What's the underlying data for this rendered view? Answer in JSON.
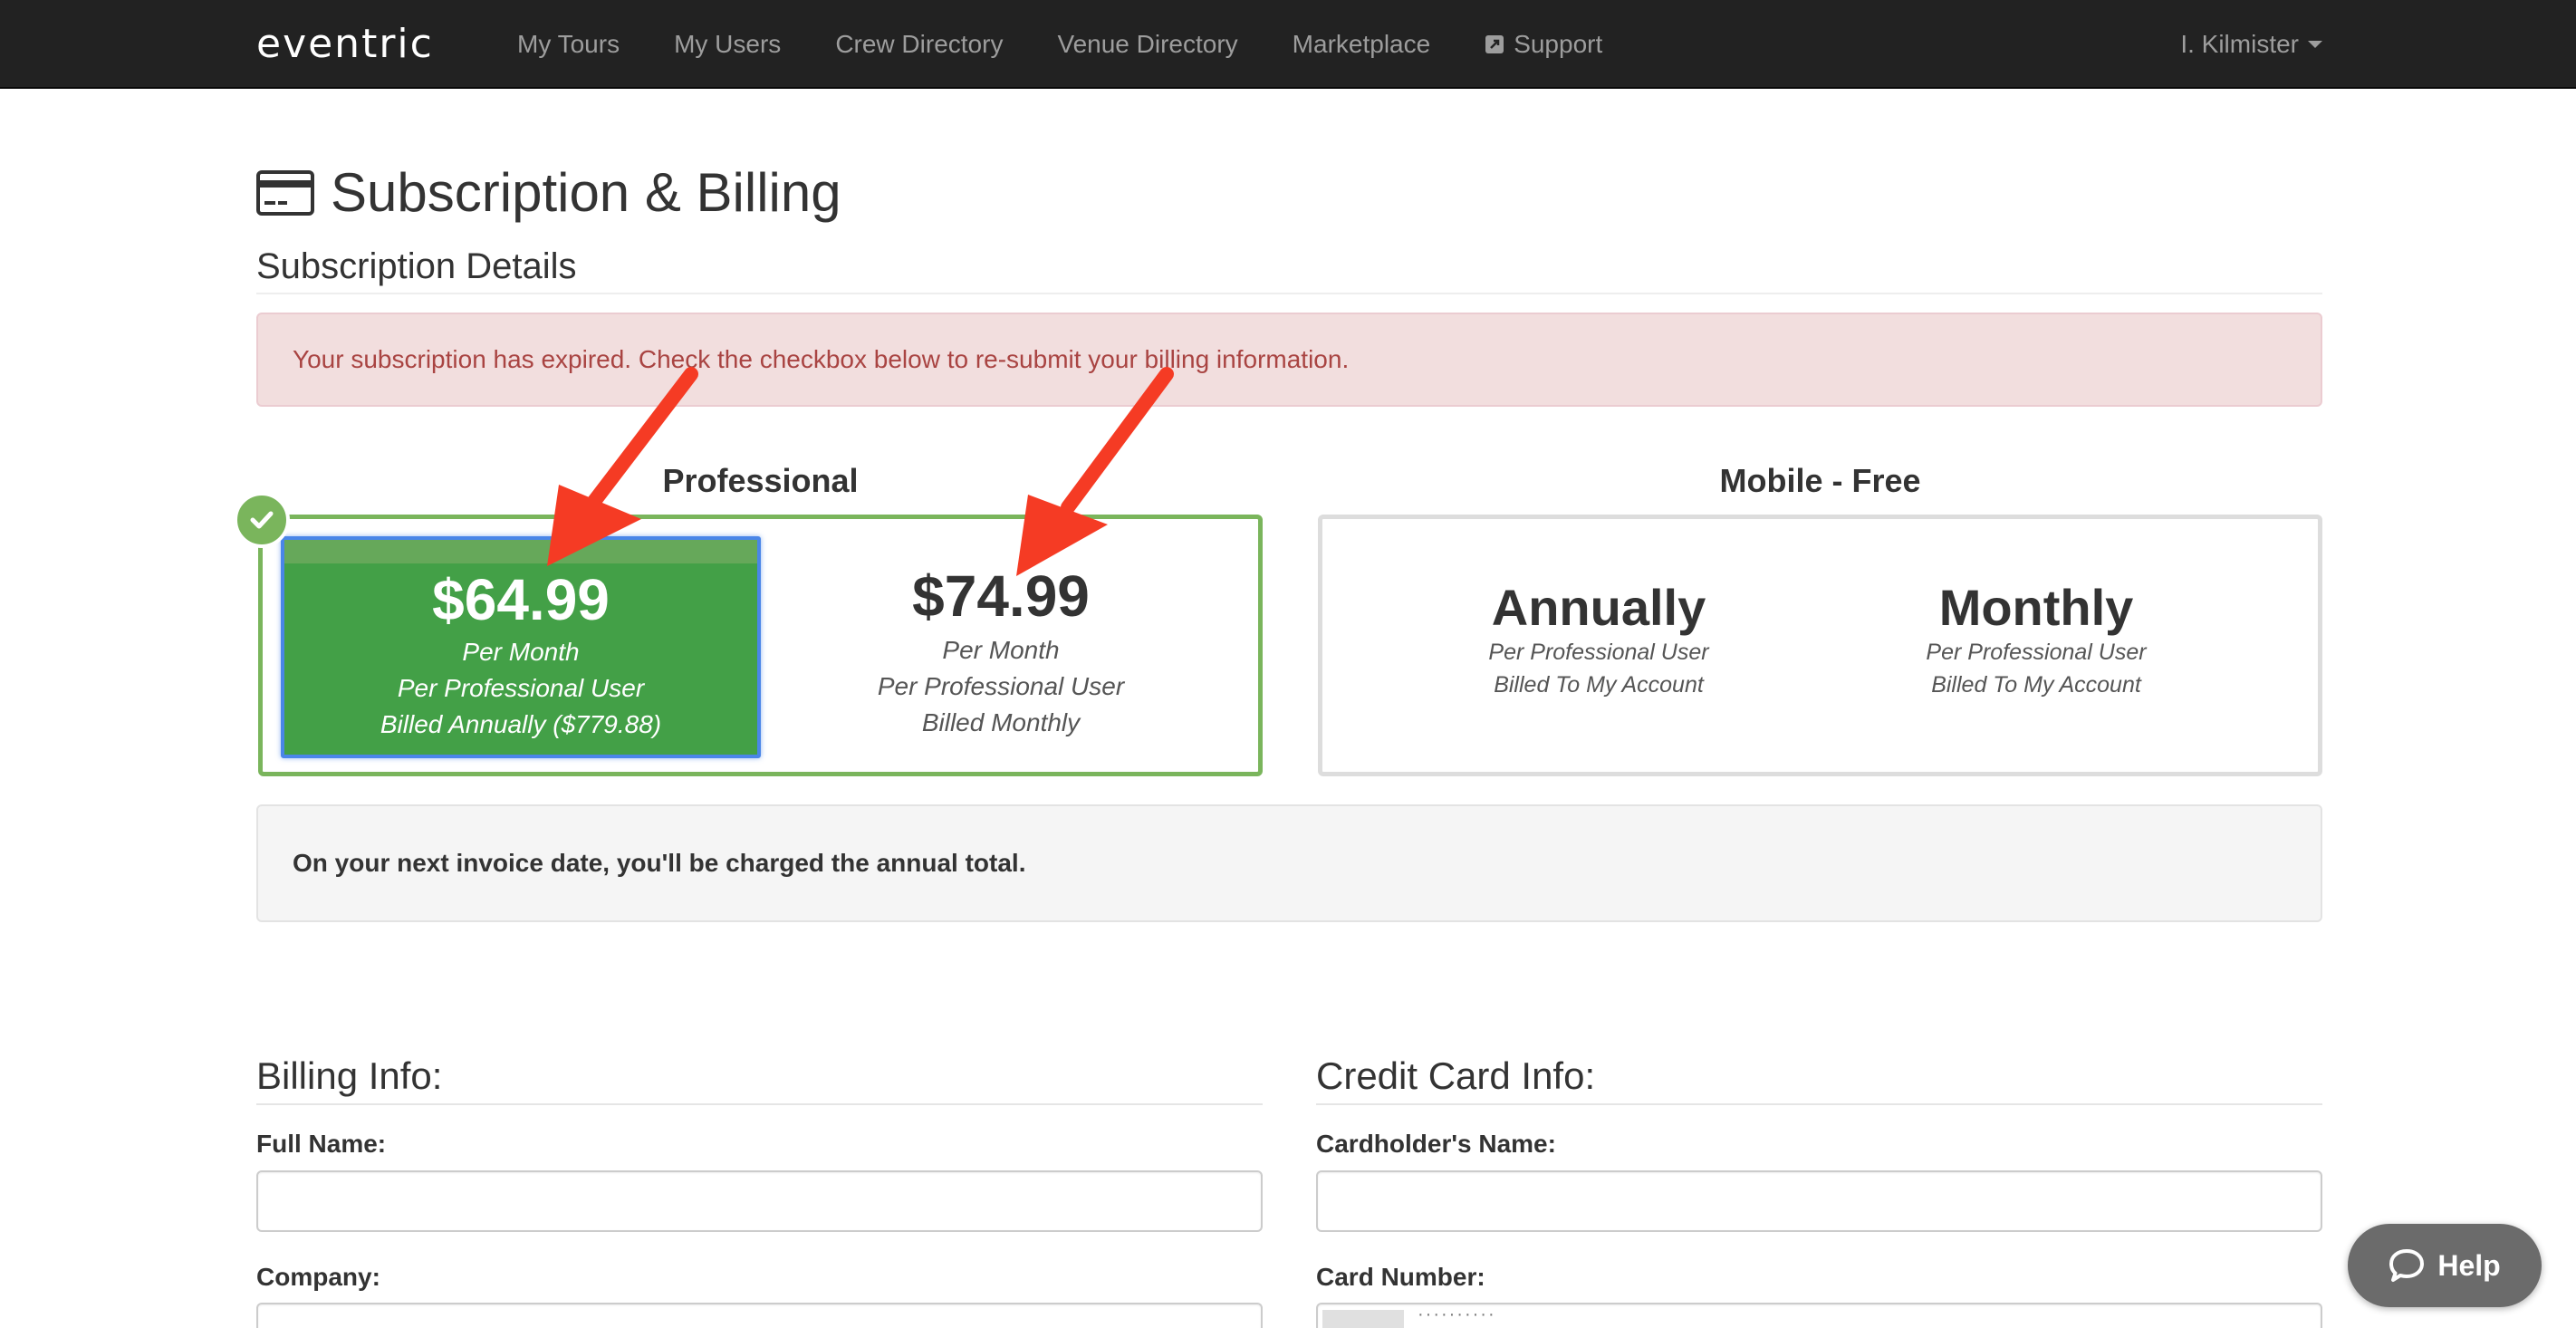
{
  "nav": {
    "brand": "eventric",
    "links": [
      "My Tours",
      "My Users",
      "Crew Directory",
      "Venue Directory",
      "Marketplace",
      "Support"
    ],
    "user": "I. Kilmister"
  },
  "page": {
    "title": "Subscription & Billing",
    "section_title": "Subscription Details"
  },
  "alert": {
    "message": "Your subscription has expired. Check the checkbox below to re-submit your billing information."
  },
  "plans": {
    "professional": {
      "label": "Professional",
      "annual": {
        "price": "$64.99",
        "lines": [
          "Per Month",
          "Per Professional User",
          "Billed Annually ($779.88)"
        ],
        "selected": true
      },
      "monthly": {
        "price": "$74.99",
        "lines": [
          "Per Month",
          "Per Professional User",
          "Billed Monthly"
        ]
      }
    },
    "mobile": {
      "label": "Mobile - Free",
      "annual": {
        "title": "Annually",
        "lines": [
          "Per Professional User",
          "Billed To My Account"
        ]
      },
      "monthly": {
        "title": "Monthly",
        "lines": [
          "Per Professional User",
          "Billed To My Account"
        ]
      }
    }
  },
  "info": {
    "message": "On your next invoice date, you'll be charged the annual total."
  },
  "billing": {
    "heading": "Billing Info:",
    "full_name_label": "Full Name:",
    "full_name_value": "",
    "company_label": "Company:"
  },
  "credit_card": {
    "heading": "Credit Card Info:",
    "cardholder_label": "Cardholder's Name:",
    "cardholder_value": "",
    "card_number_label": "Card Number:"
  },
  "help": {
    "label": "Help"
  },
  "colors": {
    "navbar": "#222222",
    "selected_plan": "#43a047",
    "plan_border": "#7ab55c",
    "alert_bg": "#f2dede",
    "alert_text": "#a94442",
    "arrow": "#f53b24"
  }
}
